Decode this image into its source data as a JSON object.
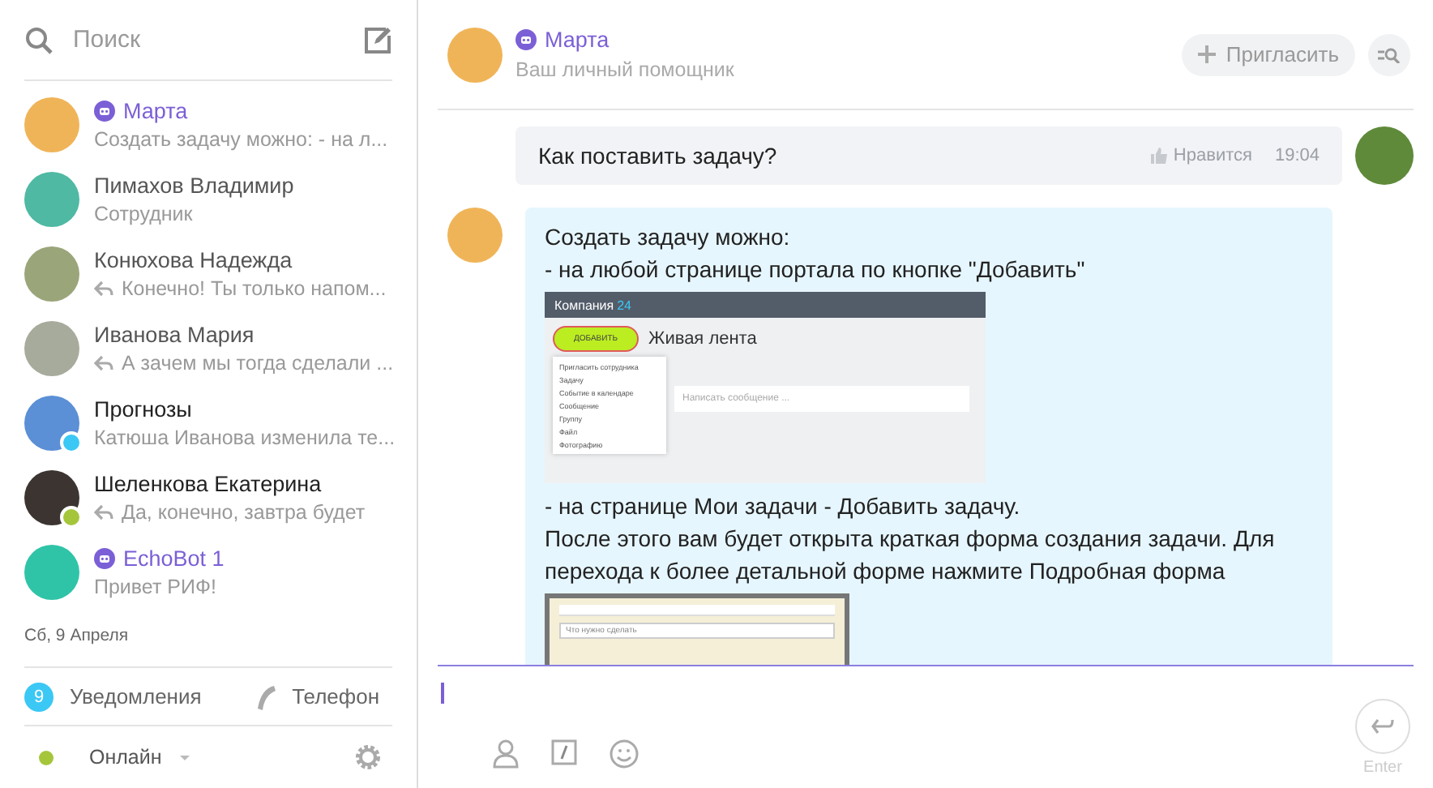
{
  "sidebar": {
    "search": {
      "placeholder": "Поиск"
    },
    "chats": [
      {
        "kind": "bot",
        "name": "Марта",
        "preview": "Создать задачу можно: - на л...",
        "reply": false,
        "online": false,
        "locked": false,
        "color": "#f0b458"
      },
      {
        "kind": "user",
        "name": "Пимахов Владимир",
        "preview": "Сотрудник",
        "reply": false,
        "online": false,
        "locked": false,
        "color": "#4fb9a3"
      },
      {
        "kind": "user",
        "name": "Конюхова Надежда",
        "preview": "Конечно! Ты только напом...",
        "reply": true,
        "online": false,
        "locked": false,
        "color": "#9aa57a"
      },
      {
        "kind": "user",
        "name": "Иванова Мария",
        "preview": "А зачем мы тогда сделали ...",
        "reply": true,
        "online": false,
        "locked": false,
        "color": "#a7ab9c"
      },
      {
        "kind": "chat",
        "name": "Прогнозы",
        "preview": "Катюша Иванова изменила те...",
        "reply": false,
        "online": false,
        "locked": true,
        "color": "#5b8fd6"
      },
      {
        "kind": "chat",
        "name": "Шеленкова Екатерина",
        "preview": "Да, конечно, завтра будет",
        "reply": true,
        "online": true,
        "locked": false,
        "color": "#3b3430"
      },
      {
        "kind": "bot",
        "name": "EchoBot 1",
        "preview": "Привет РИФ!",
        "reply": false,
        "online": false,
        "locked": false,
        "color": "#2fc4a8"
      }
    ],
    "date_separator": "Сб, 9 Апреля",
    "notifications": {
      "count": "9",
      "label": "Уведомления"
    },
    "phone": "Телефон",
    "status": {
      "label": "Онлайн",
      "color": "#a5c63b"
    }
  },
  "chat": {
    "name": "Марта",
    "subtitle": "Ваш личный помощник",
    "invite": "Пригласить",
    "messages": [
      {
        "kind": "outgoing",
        "text": "Как поставить задачу?",
        "like": "Нравится",
        "time": "19:04"
      },
      {
        "kind": "incoming",
        "parts": [
          {
            "kind": "text",
            "text": "Создать задачу можно:\n- на любой странице портала по кнопке \"Добавить\""
          },
          {
            "kind": "feed_screenshot",
            "logo": "Компания",
            "logo_number": "24",
            "add_button": "ДОБАВИТЬ",
            "title": "Живая лента",
            "menu": [
              "Пригласить сотрудника",
              "Задачу",
              "Событие в календаре",
              "Сообщение",
              "Группу",
              "Файл",
              "Фотографию"
            ],
            "composer": "Написать сообщение ..."
          },
          {
            "kind": "text",
            "text": "- на странице Мои задачи - Добавить задачу.\nПосле этого вам будет открыта краткая форма создания задачи. Для перехода к более детальной форме нажмите Подробная форма"
          },
          {
            "kind": "form_screenshot",
            "field": "Что нужно сделать"
          }
        ]
      }
    ],
    "send_label": "Enter"
  }
}
